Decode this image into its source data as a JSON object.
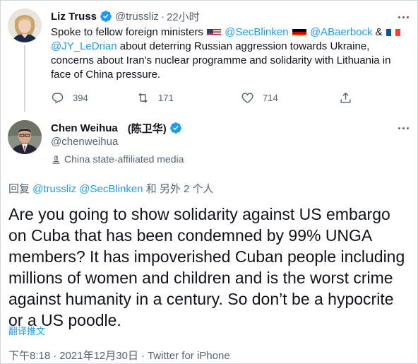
{
  "parent_tweet": {
    "display_name": "Liz Truss",
    "handle": "@trussliz",
    "separator": "·",
    "time": "22小时",
    "text": {
      "seg1": "Spoke to fellow foreign ministers ",
      "mention1": "@SecBlinken",
      "mention2": "@ABaerbock",
      "amp": " & ",
      "mention3": "@JY_LeDrian",
      "seg2": " about deterring Russian aggression towards Ukraine, concerns about Iran's nuclear programme and solidarity with Lithuania in face of China pressure."
    },
    "flags": [
      "us-flag",
      "germany-flag",
      "france-flag"
    ],
    "stats": {
      "replies": "394",
      "retweets": "171",
      "likes": "714"
    }
  },
  "main_tweet": {
    "display_name": "Chen Weihua",
    "display_name_cn": "(陈卫华)",
    "handle": "@chenweihua",
    "affiliation": "China state-affiliated media",
    "reply_prefix": "回复 ",
    "reply_mention1": "@trussliz",
    "reply_mention2": "@SecBlinken",
    "reply_suffix": " 和 另外 2 个人",
    "text": "Are you going to show solidarity against US embargo on Cuba that has been condemned by 99% UNGA members? It has impoverished Cuban people including millions of women and children and is the worst crime against humanity in a century. So don’t be a hypocrite or a US poodle.",
    "translate_label": "翻译推文",
    "time": "下午8:18",
    "date": "2021年12月30日",
    "dot": "·",
    "source": "Twitter for iPhone"
  },
  "colors": {
    "accent": "#1d9bf0",
    "text_primary": "#0f1419",
    "text_secondary": "#536471",
    "border": "#cfd9de"
  },
  "icons": [
    "verified-badge-icon",
    "more-icon",
    "reply-icon",
    "retweet-icon",
    "like-icon",
    "share-icon",
    "state-media-icon"
  ]
}
